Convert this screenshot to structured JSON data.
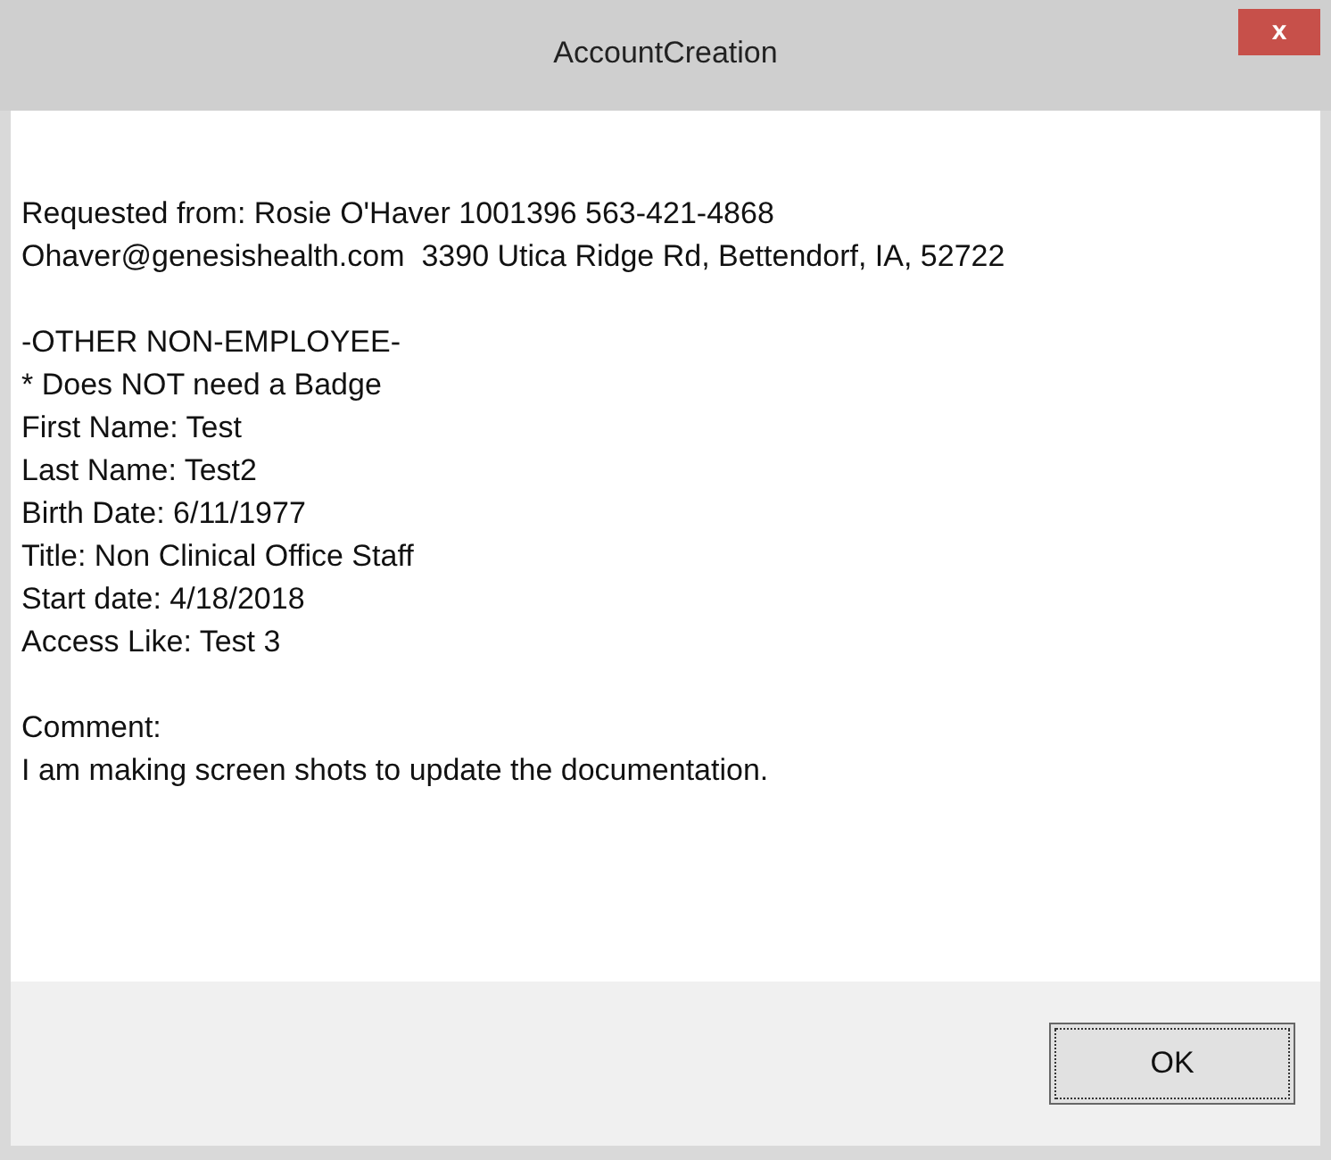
{
  "window": {
    "title": "AccountCreation",
    "close": "x"
  },
  "message": [
    [
      "Requested from: Rosie O'Haver 1001396 563-421-4868",
      "Ohaver@genesishealth.com  3390 Utica Ridge Rd, Bettendorf, IA, 52722"
    ],
    [
      "-OTHER NON-EMPLOYEE-",
      "* Does NOT need a Badge",
      "First Name: Test",
      "Last Name: Test2",
      "Birth Date: 6/11/1977",
      "Title: Non Clinical Office Staff",
      "Start date: 4/18/2018",
      "Access Like: Test 3"
    ],
    [
      "Comment:",
      "I am making screen shots to update the documentation."
    ]
  ],
  "buttons": [
    "OK"
  ]
}
